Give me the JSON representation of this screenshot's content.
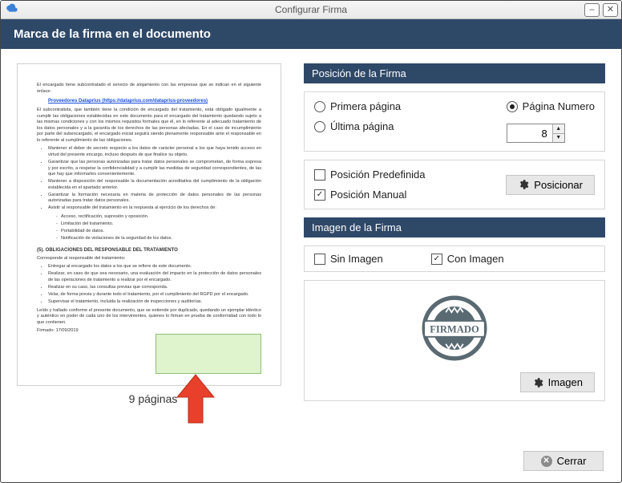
{
  "window": {
    "title": "Configurar Firma"
  },
  "header": {
    "title": "Marca de la firma en el documento"
  },
  "preview": {
    "page_count_label": "9 páginas",
    "intro": "El encargado tiene subcontratado el servicio de alojamiento con las empresas que se indican en el siguiente enlace:",
    "link": "Proveedores Dataprius (https://dataprius.com/dataprius-proveedores)",
    "claus": "El subcontratista, que también tiene la condición de encargado del tratamiento, está obligado igualmente a cumplir las obligaciones establecidas en este documento para el encargado del tratamiento quedando sujeto a las mismas condiciones y con los mismos requisitos formales que él, en lo referente al adecuado tratamiento de los datos personales y a la garantía de los derechos de las personas afectadas. En el caso de incumplimiento por parte del subencargado, el encargado inicial seguirá siendo plenamente responsable ante el responsable en lo referente al cumplimiento de las obligaciones.",
    "b1": "Mantener el deber de secreto respecto a los datos de carácter personal a los que haya tenido acceso en virtud del presente encargo, incluso después de que finalice su objeto.",
    "b2": "Garantizar que las personas autorizadas para tratar datos personales se comprometan, de forma expresa y por escrito, a respetar la confidencialidad y a cumplir las medidas de seguridad correspondientes, de las que hay que informarles convenientemente.",
    "b3": "Mantener a disposición del responsable la documentación acreditativa del cumplimiento de la obligación establecida en el apartado anterior.",
    "b4": "Garantizar la formación necesaria en materia de protección de datos personales de las personas autorizadas para tratar datos personales.",
    "b5": "Asistir al responsable del tratamiento en la respuesta al ejercicio de los derechos de:",
    "s1": "Acceso, rectificación, supresión y oposición.",
    "s2": "Limitación del tratamiento.",
    "s3": "Portabilidad de datos.",
    "s4": "Notificación de violaciones de la seguridad de los datos.",
    "sec5": "(5). OBLIGACIONES DEL RESPONSABLE DEL TRATAMIENTO",
    "resp": "Corresponde al responsable del tratamiento:",
    "r1": "Entregar al encargado los datos a los que se refiere de este documento.",
    "r2": "Realizar, en caso de que sea necesario, una evaluación del impacto en la protección de datos personales de las operaciones de tratamiento a realizar por el encargado.",
    "r3": "Realizar en su caso, las consultas previas que corresponda.",
    "r4": "Velar, de forma previa y durante todo el tratamiento, por el cumplimiento del RGPD por el encargado.",
    "r5": "Supervisar el tratamiento, incluida la realización de inspecciones y auditorías.",
    "foot": "Leído y hallado conforme el presente documento, que se extiende por duplicado, quedando un ejemplar idéntico y auténtico en poder de cada uno de los intervinientes, quienes lo firman en prueba de conformidad con todo lo que contienen.",
    "date": "Firmado: 17/09/2019"
  },
  "position": {
    "section_title": "Posición de la Firma",
    "first_page": "Primera página",
    "last_page": "Última página",
    "page_number": "Página Numero",
    "page_value": "8",
    "selected_radio": "page_number",
    "predefined": "Posición Predefinida",
    "manual": "Posición Manual",
    "manual_checked": true,
    "predefined_checked": false,
    "position_btn": "Posicionar"
  },
  "image": {
    "section_title": "Imagen de la Firma",
    "no_image": "Sin Imagen",
    "with_image": "Con Imagen",
    "with_image_checked": true,
    "no_image_checked": false,
    "stamp_text": "FIRMADO",
    "image_btn": "Imagen"
  },
  "footer": {
    "close": "Cerrar"
  }
}
